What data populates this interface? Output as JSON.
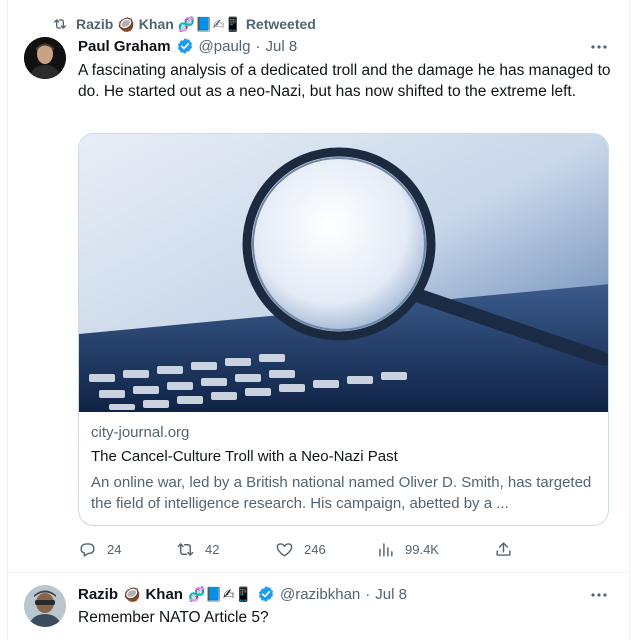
{
  "retweet": {
    "user": "Razib",
    "emoji_coconut": "🥥",
    "name_rest": "Khan",
    "emoji_badges": "🧬📘✍📱",
    "label": "Retweeted"
  },
  "tweet1": {
    "author_name": "Paul Graham",
    "handle": "@paulg",
    "separator": "·",
    "date": "Jul 8",
    "text": "A fascinating analysis of a dedicated troll and the damage he has managed to do. He started out as a neo-Nazi, but has now shifted to the extreme left.",
    "card": {
      "domain": "city-journal.org",
      "title": "The Cancel-Culture Troll with a Neo-Nazi Past",
      "description": "An online war, led by a British national named Oliver D. Smith, has targeted the field of intelligence research. His campaign, abetted by a ..."
    },
    "stats": {
      "replies": "24",
      "retweets": "42",
      "likes": "246",
      "views": "99.4K"
    }
  },
  "tweet2": {
    "author_first": "Razib",
    "emoji_coconut": "🥥",
    "author_last": "Khan",
    "emoji_badges": "🧬📘✍📱",
    "handle": "@razibkhan",
    "separator": "·",
    "date": "Jul 8",
    "text": "Remember NATO Article 5?"
  },
  "colors": {
    "text": "#0f1419",
    "secondary": "#536471",
    "verified": "#1d9bf0",
    "border": "#cfd9de"
  },
  "icons": [
    "retweet-icon",
    "verified-icon",
    "more-icon",
    "reply-icon",
    "views-icon",
    "like-icon",
    "share-icon"
  ]
}
